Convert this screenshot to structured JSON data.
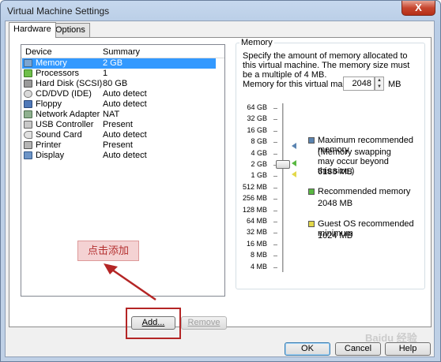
{
  "window": {
    "title": "Virtual Machine Settings",
    "close_glyph": "X"
  },
  "tabs": [
    {
      "label": "Hardware"
    },
    {
      "label": "Options"
    }
  ],
  "device_list": {
    "headers": {
      "device": "Device",
      "summary": "Summary"
    },
    "rows": [
      {
        "device": "Memory",
        "summary": "2 GB",
        "icon": "memory-icon",
        "selected": true
      },
      {
        "device": "Processors",
        "summary": "1",
        "icon": "processor-icon"
      },
      {
        "device": "Hard Disk (SCSI)",
        "summary": "80 GB",
        "icon": "hard-disk-icon"
      },
      {
        "device": "CD/DVD (IDE)",
        "summary": "Auto detect",
        "icon": "cd-dvd-icon"
      },
      {
        "device": "Floppy",
        "summary": "Auto detect",
        "icon": "floppy-icon"
      },
      {
        "device": "Network Adapter",
        "summary": "NAT",
        "icon": "network-adapter-icon"
      },
      {
        "device": "USB Controller",
        "summary": "Present",
        "icon": "usb-icon"
      },
      {
        "device": "Sound Card",
        "summary": "Auto detect",
        "icon": "sound-card-icon"
      },
      {
        "device": "Printer",
        "summary": "Present",
        "icon": "printer-icon"
      },
      {
        "device": "Display",
        "summary": "Auto detect",
        "icon": "display-icon"
      }
    ]
  },
  "buttons": {
    "add": "Add...",
    "remove": "Remove",
    "ok": "OK",
    "cancel": "Cancel",
    "help": "Help"
  },
  "annotation": {
    "callout": "点击添加"
  },
  "memory": {
    "group_title": "Memory",
    "description": "Specify the amount of memory allocated to this virtual machine. The memory size must be a multiple of 4 MB.",
    "field_label": "Memory for this virtual machine:",
    "value": "2048",
    "unit": "MB",
    "scale": [
      "64 GB",
      "32 GB",
      "16 GB",
      "8 GB",
      "4 GB",
      "2 GB",
      "1 GB",
      "512 MB",
      "256 MB",
      "128 MB",
      "64 MB",
      "32 MB",
      "16 MB",
      "8 MB",
      "4 MB"
    ],
    "legend": {
      "max_title": "Maximum recommended memory",
      "max_note": "(Memory swapping may occur beyond this size.)",
      "max_value": "6188 MB",
      "rec_title": "Recommended memory",
      "rec_value": "2048 MB",
      "guest_title": "Guest OS recommended minimum",
      "guest_value": "1024 MB"
    }
  },
  "watermark": "Baidu 经验",
  "colors": {
    "selection": "#3399ff",
    "max_marker": "#5b84b1",
    "recommended_marker": "#59b842",
    "guest_marker": "#e3d84a",
    "callout_bg": "#f4d2d3",
    "highlight": "#b42525"
  }
}
